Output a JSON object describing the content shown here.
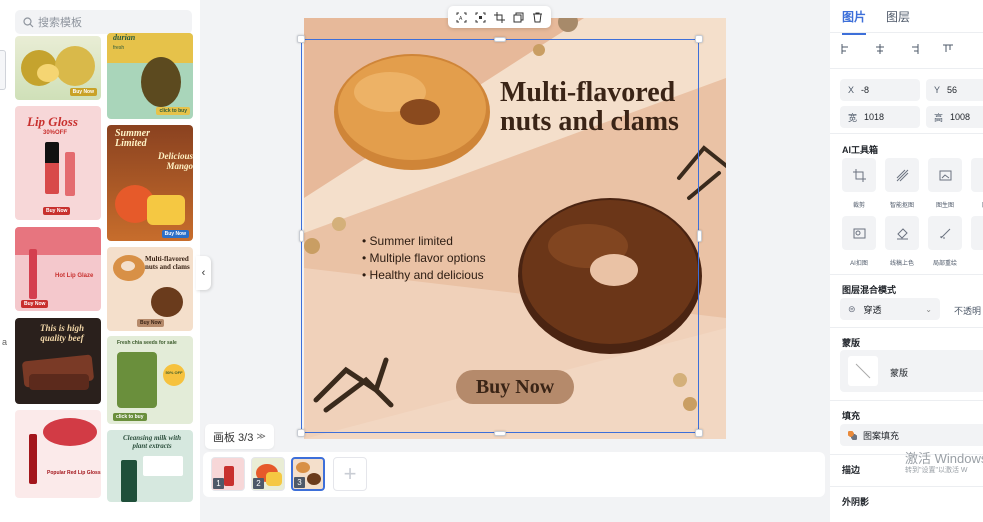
{
  "search": {
    "placeholder": "搜索模板"
  },
  "templates": [
    {
      "name": "durian-left",
      "btn": "Buy Now"
    },
    {
      "name": "durian-right",
      "title": "durian",
      "sub": "fresh",
      "btn": "click to buy"
    },
    {
      "name": "lip-gloss",
      "title": "Lip Gloss",
      "sub": "30%OFF",
      "btn": "Buy Now"
    },
    {
      "name": "mango",
      "title": "Summer Limited",
      "sub": "Delicious Mango",
      "btn": "Buy Now"
    },
    {
      "name": "hot-lip-glaze",
      "title": "Hot Lip Glaze",
      "btn": "Buy Now"
    },
    {
      "name": "bagel",
      "title": "Multi-flavored nuts and clams",
      "btn": "Buy Now"
    },
    {
      "name": "beef",
      "title": "This is high quality beef"
    },
    {
      "name": "chia",
      "title": "Fresh chia seeds for sale",
      "badge": "50% OFF",
      "btn": "click to buy"
    },
    {
      "name": "lipgloss-red",
      "title": "Popular Red Lip Gloss"
    },
    {
      "name": "cleansing-milk",
      "title": "Cleansing milk with plant extracts"
    }
  ],
  "canvas": {
    "title": "Multi-flavored nuts and clams",
    "bullets": [
      "Summer limited",
      "Multiple flavor options",
      "Healthy and delicious"
    ],
    "cta": "Buy Now"
  },
  "float_toolbar": [
    "ocr-icon",
    "scan-icon",
    "crop-icon",
    "copy-icon",
    "trash-icon"
  ],
  "artboard": {
    "label": "画板 3/3"
  },
  "thumbnails": [
    {
      "num": "1"
    },
    {
      "num": "2"
    },
    {
      "num": "3"
    }
  ],
  "right_panel": {
    "tabs": [
      "图片",
      "图层"
    ],
    "x_label": "X",
    "x_value": "-8",
    "y_label": "Y",
    "y_value": "56",
    "w_label": "宽",
    "w_value": "1018",
    "h_label": "高",
    "h_value": "1008",
    "ai_title": "AI工具箱",
    "tools": [
      "裁剪",
      "智能抠图",
      "图生图",
      "图片",
      "AI扣图",
      "线稿上色",
      "局部重绘",
      "A"
    ],
    "blend_title": "图层混合模式",
    "blend_value": "穿透",
    "opacity_label": "不透明",
    "mask_title": "蒙版",
    "mask_label": "蒙版",
    "fill_title": "填充",
    "fill_value": "图案填充",
    "stroke_title": "描边",
    "shadow_title": "外阴影"
  },
  "watermark": {
    "line1": "激活 Windows",
    "line2": "转到\"设置\"以激活 W"
  },
  "colors": {
    "accent": "#3d6fd9",
    "poster_bg": "#f4dfcb",
    "cta": "#b58a6b"
  }
}
